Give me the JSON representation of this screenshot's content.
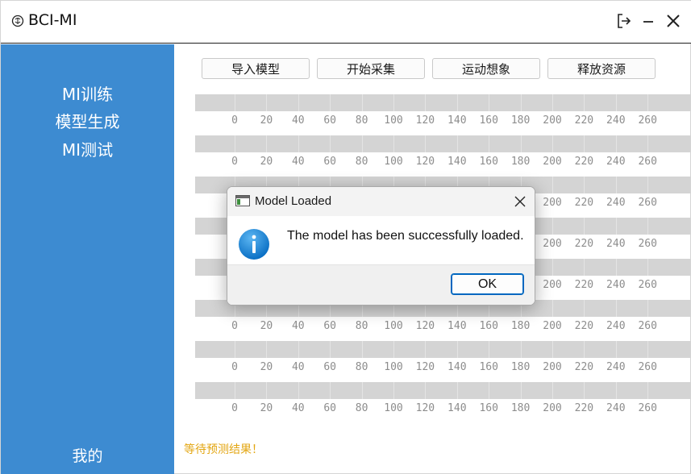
{
  "window": {
    "title": "BCI-MI",
    "icons": {
      "app": "brain-icon",
      "logout": "logout-icon",
      "minimize": "minimize-icon",
      "close": "close-icon"
    }
  },
  "sidebar": {
    "items": [
      {
        "label": "MI训练"
      },
      {
        "label": "模型生成"
      },
      {
        "label": "MI测试"
      }
    ],
    "bottom_label": "我的",
    "color": "#3d8bd1"
  },
  "toolbar": {
    "buttons": [
      {
        "label": "导入模型"
      },
      {
        "label": "开始采集"
      },
      {
        "label": "运动想象"
      },
      {
        "label": "释放资源"
      }
    ]
  },
  "plot": {
    "tick_labels": [
      "0",
      "20",
      "40",
      "60",
      "80",
      "100",
      "120",
      "140",
      "160",
      "180",
      "200",
      "220",
      "240",
      "260"
    ],
    "channel_count": 8
  },
  "status": {
    "text": "等待预测结果！",
    "color": "#e3a612"
  },
  "dialog": {
    "title": "Model Loaded",
    "message": "The model has been successfully loaded.",
    "ok_label": "OK",
    "icon": "info-icon",
    "accent": "#0067c0"
  }
}
